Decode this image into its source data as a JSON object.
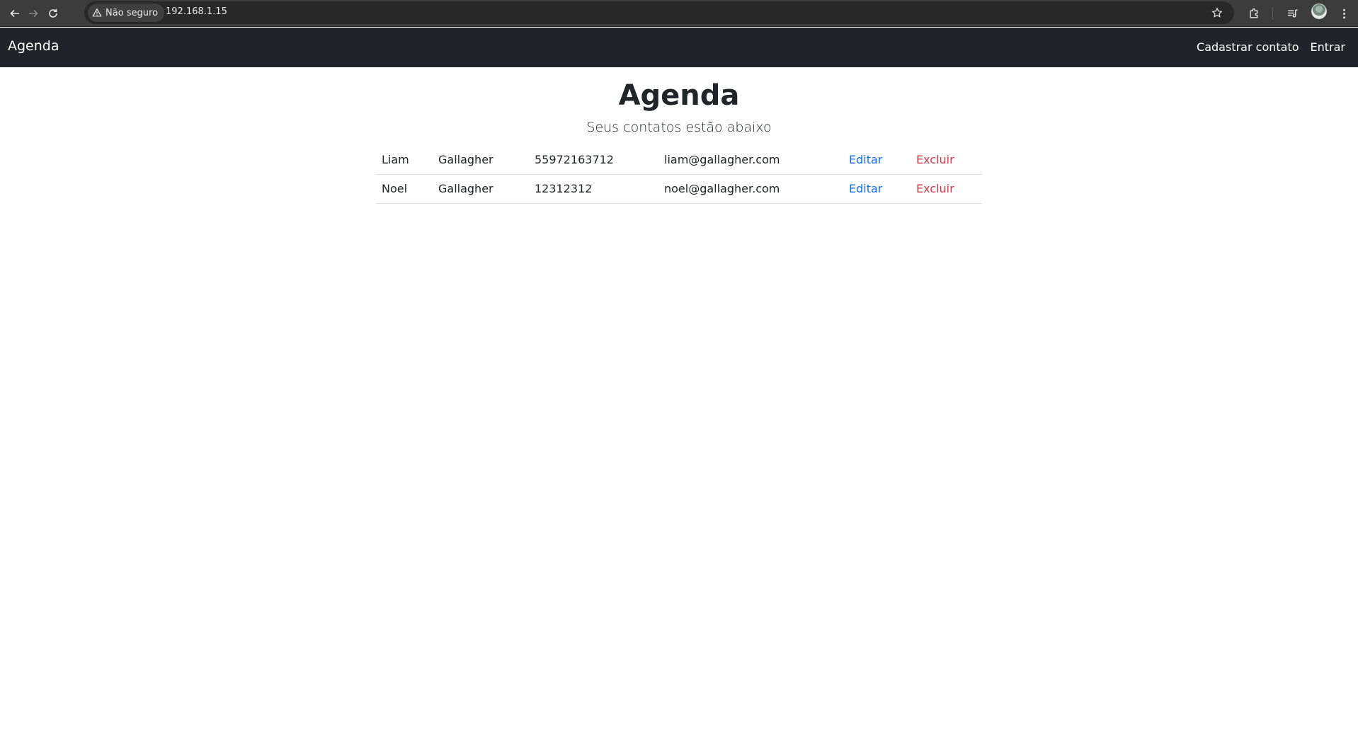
{
  "browser": {
    "security_label": "Não seguro",
    "url": "192.168.1.15"
  },
  "navbar": {
    "brand": "Agenda",
    "links": [
      "Cadastrar contato",
      "Entrar"
    ]
  },
  "main": {
    "title": "Agenda",
    "subtitle": "Seus contatos estão abaixo",
    "contacts": [
      {
        "first_name": "Liam",
        "last_name": "Gallagher",
        "phone": "55972163712",
        "email": "liam@gallagher.com",
        "edit_label": "Editar",
        "delete_label": "Excluir"
      },
      {
        "first_name": "Noel",
        "last_name": "Gallagher",
        "phone": "12312312",
        "email": "noel@gallagher.com",
        "edit_label": "Editar",
        "delete_label": "Excluir"
      }
    ]
  },
  "colors": {
    "navbar_bg": "#212529",
    "edit_link": "#0d6efd",
    "delete_link": "#dc3545"
  }
}
